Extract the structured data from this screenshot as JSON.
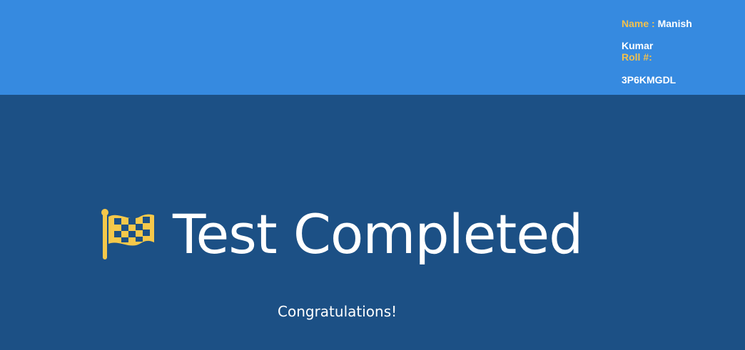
{
  "header": {
    "name_label": "Name :",
    "name_value": "Manish Kumar",
    "roll_label": "Roll #:",
    "roll_value": "3P6KMGDL",
    "background_color": "#368ae0"
  },
  "main": {
    "icon": "chequered-flag-icon",
    "title": "Test Completed",
    "message": "Congratulations!",
    "background_color": "#1c5085"
  }
}
